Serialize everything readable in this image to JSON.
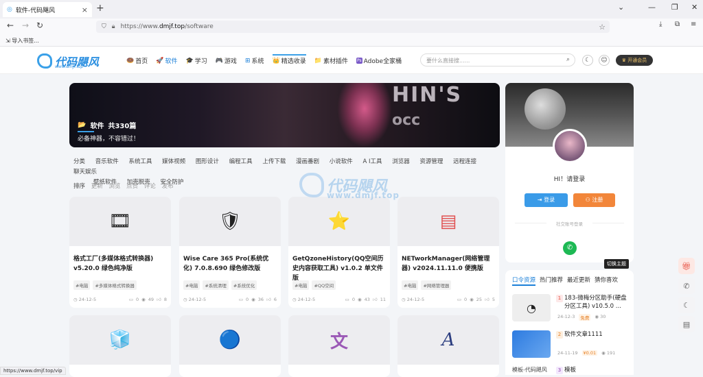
{
  "browser": {
    "tab_title": "软件-代码飓风",
    "tab_close": "×",
    "new_tab": "+",
    "url_scheme": "https://www.",
    "url_host": "dmjf.top",
    "url_path": "/software",
    "bookmark_label": "导入书签...",
    "status_url": "https://www.dmjf.top/vip"
  },
  "site": {
    "logo_text": "代码飓风",
    "logo_sub": "www.dmjf.top",
    "menu": [
      {
        "label": "首页",
        "icon": "🍩"
      },
      {
        "label": "软件",
        "icon": "🚀"
      },
      {
        "label": "学习",
        "icon": "🎓"
      },
      {
        "label": "游戏",
        "icon": "🎮"
      },
      {
        "label": "系统",
        "icon": "⊞"
      },
      {
        "label": "精选收录",
        "icon": "👑"
      },
      {
        "label": "素材插件",
        "icon": "📁"
      },
      {
        "label": "Adobe全家桶",
        "icon": "Ps"
      }
    ],
    "search_placeholder": "要什么直接搜......",
    "vip_label": "开通会员"
  },
  "banner": {
    "title": "软件",
    "count": "共330篇",
    "desc": "必备神器，不容错过！",
    "sign_top": "HIN'S",
    "sign_bottom": "occ"
  },
  "categories": {
    "label": "分类",
    "items": [
      "音乐软件",
      "系统工具",
      "媒体视频",
      "图形设计",
      "编程工具",
      "上传下载",
      "漫画番剧",
      "小说软件",
      "A I工具",
      "浏览器",
      "资源管理",
      "远程连接",
      "聊天娱乐",
      "壁纸软件",
      "加壳脱壳",
      "安全防护"
    ]
  },
  "sort": {
    "label": "排序",
    "items": [
      "更新",
      "浏览",
      "点赞",
      "评论",
      "发布"
    ]
  },
  "watermark": {
    "text": "代码飓风",
    "sub": "www.dmjf.top"
  },
  "cards": [
    {
      "title": "格式工厂(多媒体格式转换器) v5.20.0 绿色纯净版",
      "tags": [
        "#电脑",
        "#多媒体格式转换器"
      ],
      "date": "24-12-5",
      "comments": "0",
      "views": "49",
      "likes": "8",
      "icon": "🎞"
    },
    {
      "title": "Wise Care 365 Pro(系统优化) 7.0.8.690 绿色修改版",
      "tags": [
        "#电脑",
        "#系统清理",
        "#系统优化"
      ],
      "date": "24-12-5",
      "comments": "0",
      "views": "36",
      "likes": "6",
      "icon": "🛡"
    },
    {
      "title": "GetQzoneHistory(QQ空间历史内容获取工具) v1.0.2 单文件版",
      "tags": [
        "#电脑",
        "#QQ空间"
      ],
      "date": "24-12-5",
      "comments": "0",
      "views": "43",
      "likes": "11",
      "icon": "⭐"
    },
    {
      "title": "NETworkManager(网络管理器) v2024.11.11.0 便携版",
      "tags": [
        "#电脑",
        "#网络管理器"
      ],
      "date": "24-12-5",
      "comments": "0",
      "views": "25",
      "likes": "5",
      "icon": "▤"
    }
  ],
  "cards_row2": [
    {
      "icon": "🧊"
    },
    {
      "icon": "🔵"
    },
    {
      "icon": "文"
    },
    {
      "icon": "A"
    }
  ],
  "profile": {
    "greeting": "HI！请登录",
    "login": "登录",
    "register": "注册",
    "social_label": "社交账号登录",
    "tooltip": "切换主题"
  },
  "hot": {
    "tabs": [
      "口令资源",
      "热门推荐",
      "最近更新",
      "猜你喜欢"
    ],
    "items": [
      {
        "rank": "1",
        "title": "183-微梅分区助手(硬盘分区工具) v10.5.0 ...",
        "date": "24-12-3",
        "badge": "免费",
        "views": "30"
      },
      {
        "rank": "2",
        "title": "软件文章1111",
        "date": "24-11-19",
        "badge": "¥0.01",
        "views": "191"
      },
      {
        "rank": "3",
        "title": "模板",
        "date": "",
        "badge": "",
        "views": ""
      }
    ],
    "item3_left": "模板-代码飓风"
  },
  "colors": {
    "accent": "#1a7fd8",
    "orange": "#f2863a",
    "wechat": "#1db954"
  }
}
